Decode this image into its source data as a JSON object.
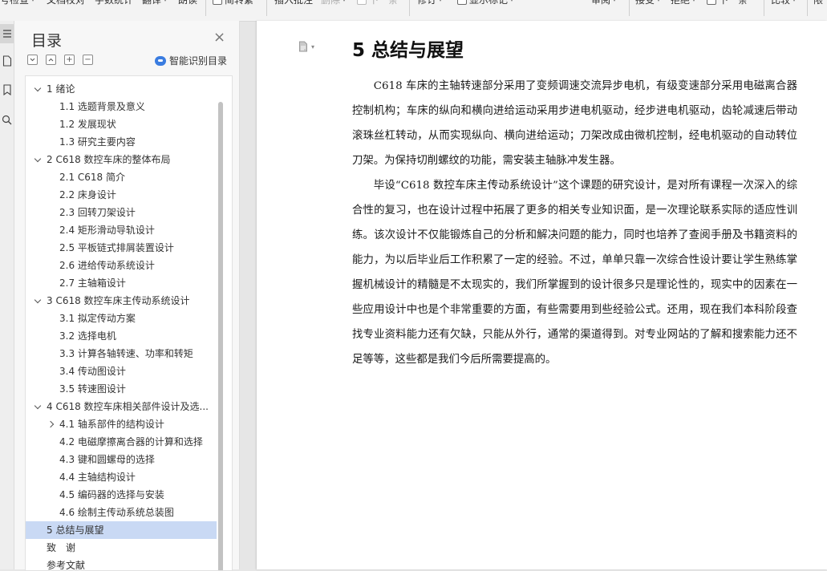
{
  "toolbar": {
    "items": [
      "号检查",
      "文档校对",
      "字数统计",
      "翻译",
      "朗读",
      "简转繁",
      "插入批注",
      "删除",
      "下一条",
      "修订",
      "显示标记",
      "审阅",
      "接受",
      "拒绝",
      "下一条",
      "比较",
      "限"
    ]
  },
  "toc": {
    "title": "目录",
    "smart_label": "智能识别目录",
    "items": [
      {
        "text": "1 绪论",
        "level": 1,
        "expand": "down"
      },
      {
        "text": "1.1 选题背景及意义",
        "level": 2
      },
      {
        "text": "1.2 发展现状",
        "level": 2
      },
      {
        "text": "1.3 研究主要内容",
        "level": 2
      },
      {
        "text": "2 C618 数控车床的整体布局",
        "level": 1,
        "expand": "down"
      },
      {
        "text": "2.1 C618 简介",
        "level": 2
      },
      {
        "text": "2.2  床身设计",
        "level": 2
      },
      {
        "text": "2.3  回转刀架设计",
        "level": 2
      },
      {
        "text": "2.4  矩形滑动导轨设计",
        "level": 2
      },
      {
        "text": "2.5 平板链式排屑装置设计",
        "level": 2
      },
      {
        "text": "2.6 进给传动系统设计",
        "level": 2
      },
      {
        "text": "2.7 主轴箱设计",
        "level": 2
      },
      {
        "text": "3 C618 数控车床主传动系统设计",
        "level": 1,
        "expand": "down"
      },
      {
        "text": "3.1  拟定传动方案",
        "level": 2
      },
      {
        "text": "3.2  选择电机",
        "level": 2
      },
      {
        "text": "3.3  计算各轴转速、功率和转矩",
        "level": 2
      },
      {
        "text": "3.4  传动图设计",
        "level": 2
      },
      {
        "text": "3.5  转速图设计",
        "level": 2
      },
      {
        "text": "4 C618 数控车床相关部件设计及选...",
        "level": 1,
        "expand": "down"
      },
      {
        "text": "4.1 轴系部件的结构设计",
        "level": 2,
        "expand": "right"
      },
      {
        "text": "4.2 电磁摩擦离合器的计算和选择",
        "level": 2
      },
      {
        "text": "4.3 键和圆螺母的选择",
        "level": 2
      },
      {
        "text": "4.4 主轴结构设计",
        "level": 2
      },
      {
        "text": "4.5 编码器的选择与安装",
        "level": 2
      },
      {
        "text": "4.6 绘制主传动系统总装图",
        "level": 2
      },
      {
        "text": "5 总结与展望",
        "level": 1,
        "active": true
      },
      {
        "text": "致　谢",
        "level": 1
      },
      {
        "text": "参考文献",
        "level": 1
      }
    ]
  },
  "document": {
    "heading": "5 总结与展望",
    "paragraphs": [
      "C618 车床的主轴转速部分采用了变频调速交流异步电机，有级变速部分采用电磁离合器控制机构；车床的纵向和横向进给运动采用步进电机驱动，经步进电机驱动，齿轮减速后带动滚珠丝杠转动，从而实现纵向、横向进给运动；刀架改成由微机控制，经电机驱动的自动转位刀架。为保持切削螺纹的功能，需安装主轴脉冲发生器。",
      "毕设“C618 数控车床主传动系统设计”这个课题的研究设计，是对所有课程一次深入的综合性的复习，也在设计过程中拓展了更多的相关专业知识面，是一次理论联系实际的适应性训练。该次设计不仅能锻炼自己的分析和解决问题的能力，同时也培养了查阅手册及书籍资料的能力，为以后毕业后工作积累了一定的经验。不过，单单只靠一次综合性设计要让学生熟练掌握机械设计的精髓是不太现实的，我们所掌握到的设计很多只是理论性的，现实中的因素在一些应用设计中也是个非常重要的方面，有些需要用到些经验公式。还用，现在我们本科阶段查找专业资料能力还有欠缺，只能从外行，通常的渠道得到。对专业网站的了解和搜索能力还不足等等，这些都是我们今后所需要提高的。"
    ]
  }
}
